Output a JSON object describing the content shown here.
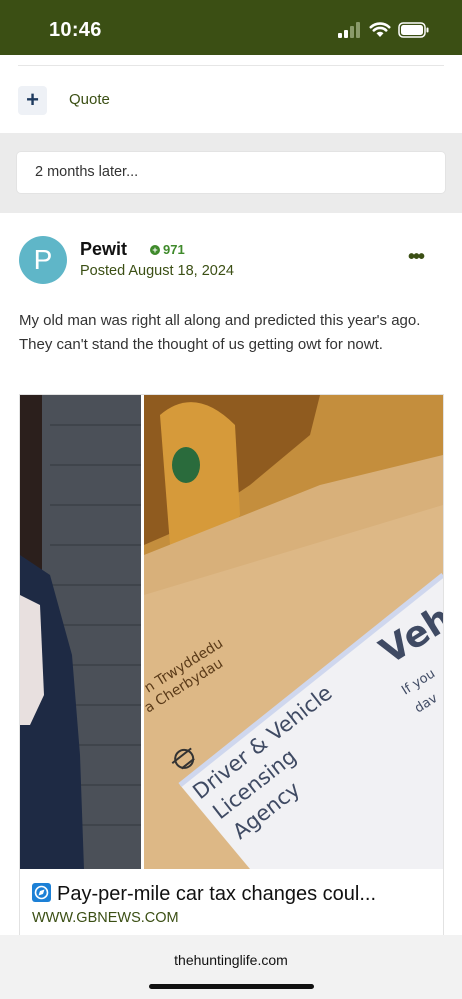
{
  "status_bar": {
    "time": "10:46"
  },
  "actions": {
    "add_icon": "plus-icon",
    "quote_label": "Quote"
  },
  "separator": {
    "text": "2 months later..."
  },
  "post": {
    "avatar_letter": "P",
    "author": "Pewit",
    "reputation": "971",
    "posted": "Posted August 18, 2024",
    "body": "My old man was right all along and predicted this year's ago. They can't stand the thought of us getting owt for nowt.",
    "link": {
      "title": "Pay-per-mile car tax changes coul...",
      "url": "WWW.GBNEWS.COM",
      "image_text": {
        "agency_line1": "Driver & Vehicle",
        "agency_line2": "Licensing",
        "agency_line3": "Agency",
        "welsh_line1": "n Trwyddedu",
        "welsh_line2": "a Cherbydau",
        "heading_fragment": "Veh",
        "small1": "If you",
        "small2": "dav"
      }
    }
  },
  "browser": {
    "domain": "thehuntinglife.com"
  },
  "colors": {
    "header": "#3b4f14",
    "accent": "#3f8a2b",
    "avatar": "#5fb6c8"
  }
}
